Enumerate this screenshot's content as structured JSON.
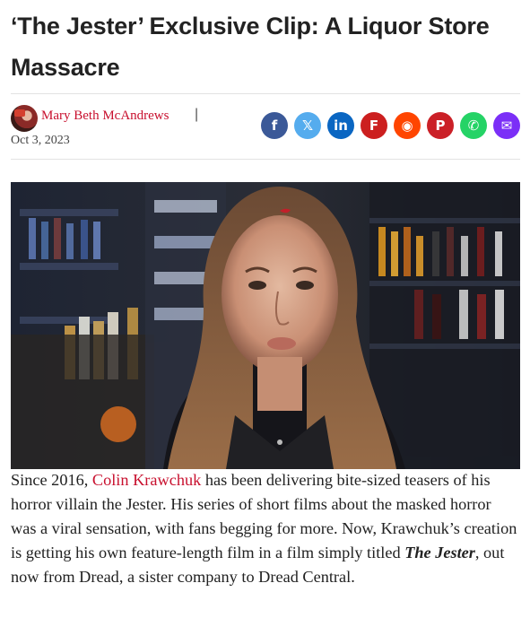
{
  "article": {
    "title": "‘The Jester’ Exclusive Clip: A Liquor Store Massacre",
    "author": "Mary Beth McAndrews",
    "separator": "|",
    "date": "Oct 3, 2023",
    "body": {
      "p1_a": "Since 2016, ",
      "p1_link": "Colin Krawchuk",
      "p1_b": " has been delivering bite-sized teasers of his horror villain the Jester. His series of short films about the masked horror was a viral sensation, with fans begging for more. Now, Krawchuk’s creation is getting his own feature-length film in a film simply titled ",
      "p1_em": "The Jester",
      "p1_c": ", out now from Dread, a sister company to Dread Central."
    }
  },
  "share": [
    {
      "name": "facebook-icon",
      "glyph": "f",
      "color": "#3b5998"
    },
    {
      "name": "x-icon",
      "glyph": "𝕏",
      "color": "#55acee"
    },
    {
      "name": "linkedin-icon",
      "glyph": "in",
      "color": "#0a66c2"
    },
    {
      "name": "flipboard-icon",
      "glyph": "F",
      "color": "#cc1f1f"
    },
    {
      "name": "reddit-icon",
      "glyph": "◉",
      "color": "#ff4500"
    },
    {
      "name": "pinterest-icon",
      "glyph": "P",
      "color": "#cb2027"
    },
    {
      "name": "whatsapp-icon",
      "glyph": "✆",
      "color": "#25d366"
    },
    {
      "name": "email-icon",
      "glyph": "✉",
      "color": "#7b2ff7"
    }
  ]
}
